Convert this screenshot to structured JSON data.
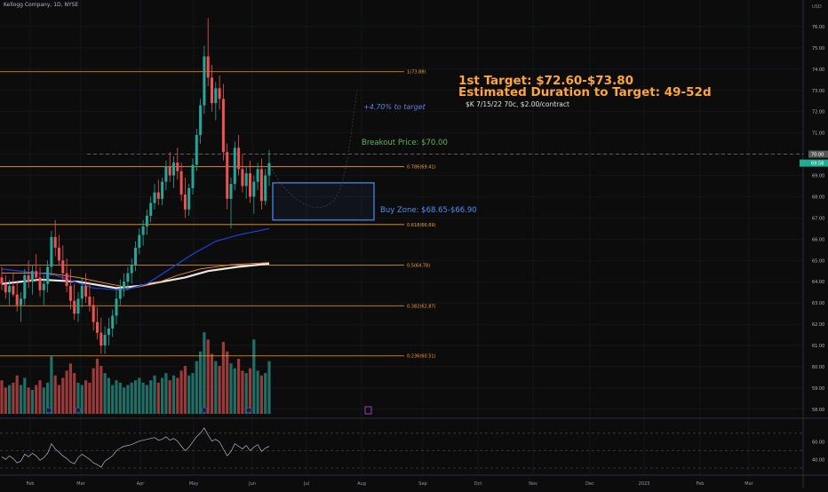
{
  "header": {
    "symbol_title": "Kellogg Company, 1D, NYSE"
  },
  "colors": {
    "background": "#0c0c0c",
    "grid": "#1c1e26",
    "up": "#26a69a",
    "down": "#ef5350",
    "vol_up": "#1f6f66",
    "vol_down": "#9c3a3a",
    "fib": "#f59d29",
    "blue_box": "#4f8df5",
    "ma_short": "#1e3dce",
    "ma_mid": "#ff8f2f",
    "ma_long": "#e8e8e8",
    "rsi": "#b2b5be",
    "annotation_target": "#ffa53a",
    "annotation_breakout": "#5fb35f",
    "annotation_buy": "#4f8df5",
    "annotation_pct": "#5d7fe0",
    "annotation_option": "#e0e0e0",
    "price_tag_breakout": "#5a5a5a",
    "price_tag_last": "#22ab94"
  },
  "annotations": {
    "target": "1st Target: $72.60-$73.80",
    "duration": "Estimated Duration to Target: 49-52d",
    "option": "$K 7/15/22 70c, $2.00/contract",
    "pct_to_target": "+4.70% to target",
    "breakout": "Breakout Price: $70.00",
    "buy_zone": "Buy Zone: $68.65-$66.90"
  },
  "chart_data": {
    "type": "candlestick",
    "title": "Kellogg Company, 1D, NYSE",
    "y_axis": {
      "label": "USD",
      "ticks": [
        58,
        59,
        60,
        61,
        62,
        63,
        64,
        65,
        66,
        67,
        68,
        69,
        70,
        71,
        72,
        73,
        74,
        75,
        76
      ],
      "range": [
        57.7,
        76.5
      ]
    },
    "x_axis": {
      "tick_labels": [
        "Feb",
        "Mar",
        "Apr",
        "May",
        "Jun",
        "Jul",
        "Aug",
        "Sep",
        "Oct",
        "Nov",
        "Dec",
        "2023",
        "Feb",
        "Mar"
      ]
    },
    "fib_levels": [
      {
        "label": "1(73.88)",
        "value": 73.88
      },
      {
        "label": "0.786(69.41)",
        "value": 69.41
      },
      {
        "label": "0.618(66.69)",
        "value": 66.69
      },
      {
        "label": "0.5(64.78)",
        "value": 64.78
      },
      {
        "label": "0.382(62.87)",
        "value": 62.87
      },
      {
        "label": "0.236(60.51)",
        "value": 60.51
      }
    ],
    "price_tags": [
      {
        "label": "70.00",
        "value": 70.0
      },
      {
        "label": "69.58",
        "value": 69.58
      }
    ],
    "breakout_level": 70.0,
    "buy_zone": {
      "top": 68.65,
      "bottom": 66.9
    },
    "rsi": {
      "range": [
        25,
        80
      ],
      "ticks": [
        40,
        60
      ],
      "band_lines": [
        30,
        50,
        70
      ]
    },
    "candles": [
      [
        64.2,
        64.7,
        63.6,
        63.9
      ],
      [
        63.9,
        64.3,
        63.2,
        63.5
      ],
      [
        63.5,
        64.1,
        62.9,
        63.8
      ],
      [
        63.8,
        64.4,
        63.3,
        63.4
      ],
      [
        63.4,
        64.0,
        62.6,
        62.9
      ],
      [
        62.9,
        63.5,
        62.1,
        63.2
      ],
      [
        63.2,
        64.6,
        62.9,
        64.3
      ],
      [
        64.3,
        65.0,
        63.7,
        64.0
      ],
      [
        64.0,
        64.8,
        63.4,
        64.5
      ],
      [
        64.5,
        65.3,
        64.0,
        64.2
      ],
      [
        64.2,
        64.7,
        63.3,
        63.6
      ],
      [
        63.6,
        64.3,
        62.9,
        63.9
      ],
      [
        63.9,
        65.0,
        63.5,
        64.7
      ],
      [
        64.7,
        66.4,
        64.3,
        66.1
      ],
      [
        66.1,
        66.9,
        65.2,
        65.6
      ],
      [
        65.6,
        66.2,
        64.8,
        65.0
      ],
      [
        65.0,
        65.7,
        64.1,
        64.4
      ],
      [
        64.4,
        65.1,
        63.5,
        63.8
      ],
      [
        63.8,
        64.6,
        62.7,
        63.1
      ],
      [
        63.1,
        63.9,
        62.2,
        62.5
      ],
      [
        62.5,
        63.5,
        62.1,
        63.2
      ],
      [
        63.2,
        64.2,
        62.8,
        63.8
      ],
      [
        63.8,
        64.4,
        63.0,
        63.3
      ],
      [
        63.3,
        64.0,
        62.6,
        62.9
      ],
      [
        62.9,
        63.3,
        61.7,
        62.1
      ],
      [
        62.1,
        62.8,
        61.3,
        61.6
      ],
      [
        61.6,
        62.3,
        60.6,
        61.0
      ],
      [
        61.0,
        61.9,
        60.6,
        61.5
      ],
      [
        61.5,
        62.3,
        61.0,
        61.8
      ],
      [
        61.8,
        62.7,
        61.4,
        62.4
      ],
      [
        62.4,
        63.6,
        62.0,
        63.2
      ],
      [
        63.2,
        64.1,
        62.9,
        63.7
      ],
      [
        63.7,
        64.4,
        63.3,
        64.0
      ],
      [
        64.0,
        64.7,
        63.6,
        64.4
      ],
      [
        64.4,
        65.1,
        63.9,
        64.8
      ],
      [
        64.8,
        65.9,
        64.5,
        65.6
      ],
      [
        65.6,
        66.5,
        65.3,
        66.2
      ],
      [
        66.2,
        66.9,
        65.7,
        66.6
      ],
      [
        66.6,
        67.4,
        66.2,
        67.1
      ],
      [
        67.1,
        68.0,
        66.8,
        67.7
      ],
      [
        67.7,
        68.6,
        67.4,
        68.2
      ],
      [
        68.2,
        68.8,
        67.6,
        67.9
      ],
      [
        67.9,
        68.9,
        67.6,
        68.7
      ],
      [
        68.7,
        69.7,
        68.3,
        69.4
      ],
      [
        69.4,
        70.1,
        68.7,
        69.0
      ],
      [
        69.0,
        69.9,
        68.4,
        69.6
      ],
      [
        69.6,
        70.3,
        68.8,
        69.2
      ],
      [
        69.2,
        69.6,
        67.8,
        68.1
      ],
      [
        68.1,
        68.9,
        67.0,
        67.4
      ],
      [
        67.4,
        68.6,
        67.1,
        68.4
      ],
      [
        68.4,
        69.8,
        68.1,
        69.5
      ],
      [
        69.5,
        71.2,
        69.2,
        70.9
      ],
      [
        70.9,
        72.6,
        70.5,
        72.3
      ],
      [
        72.3,
        75.1,
        71.9,
        74.6
      ],
      [
        74.6,
        76.4,
        73.2,
        73.6
      ],
      [
        73.6,
        74.2,
        72.0,
        72.4
      ],
      [
        72.4,
        73.4,
        71.6,
        73.1
      ],
      [
        73.1,
        73.7,
        72.1,
        72.6
      ],
      [
        72.6,
        73.3,
        69.7,
        70.1
      ],
      [
        70.1,
        70.5,
        67.4,
        67.9
      ],
      [
        67.9,
        68.9,
        66.5,
        68.6
      ],
      [
        68.6,
        70.6,
        68.3,
        70.3
      ],
      [
        70.3,
        70.9,
        69.0,
        69.3
      ],
      [
        69.3,
        70.0,
        68.2,
        68.5
      ],
      [
        68.5,
        69.4,
        67.9,
        69.1
      ],
      [
        69.1,
        69.7,
        67.7,
        68.0
      ],
      [
        68.0,
        69.0,
        67.2,
        68.7
      ],
      [
        68.7,
        69.6,
        68.3,
        69.3
      ],
      [
        69.3,
        69.8,
        67.4,
        67.8
      ],
      [
        67.8,
        69.3,
        67.6,
        69.0
      ],
      [
        69.0,
        70.2,
        68.5,
        69.58
      ]
    ],
    "volume": [
      1.4,
      1.1,
      1.2,
      1.3,
      1.6,
      1.2,
      1.5,
      1.1,
      1.0,
      1.2,
      1.4,
      1.1,
      1.3,
      2.4,
      1.6,
      1.2,
      1.5,
      1.8,
      2.1,
      1.7,
      1.3,
      1.2,
      1.4,
      1.3,
      1.9,
      2.3,
      2.0,
      1.7,
      1.5,
      1.2,
      1.4,
      1.3,
      1.1,
      1.2,
      1.3,
      1.4,
      1.5,
      1.3,
      1.2,
      1.4,
      1.6,
      1.3,
      1.5,
      1.7,
      1.4,
      1.6,
      1.5,
      1.8,
      2.0,
      1.6,
      1.7,
      2.2,
      2.6,
      3.4,
      3.1,
      2.5,
      2.2,
      2.0,
      3.0,
      2.6,
      2.1,
      1.9,
      2.3,
      1.8,
      1.7,
      1.9,
      3.1,
      1.8,
      1.6,
      1.7,
      2.2
    ],
    "ma_short": [
      [
        0,
        64.6
      ],
      [
        14,
        64.3
      ],
      [
        24,
        63.7
      ],
      [
        32,
        63.6
      ],
      [
        38,
        63.9
      ],
      [
        44,
        64.6
      ],
      [
        50,
        65.3
      ],
      [
        56,
        65.9
      ],
      [
        62,
        66.2
      ],
      [
        70,
        66.5
      ]
    ],
    "ma_mid": [
      [
        0,
        64.4
      ],
      [
        12,
        64.4
      ],
      [
        20,
        64.2
      ],
      [
        28,
        63.9
      ],
      [
        34,
        63.7
      ],
      [
        40,
        63.9
      ],
      [
        46,
        64.3
      ],
      [
        52,
        64.6
      ],
      [
        60,
        64.8
      ],
      [
        70,
        64.9
      ]
    ],
    "ma_long": [
      [
        0,
        63.9
      ],
      [
        10,
        64.1
      ],
      [
        20,
        64.0
      ],
      [
        30,
        63.7
      ],
      [
        36,
        63.8
      ],
      [
        42,
        64.0
      ],
      [
        48,
        64.2
      ],
      [
        54,
        64.5
      ],
      [
        62,
        64.7
      ],
      [
        70,
        64.85
      ]
    ],
    "rsi_values": [
      43,
      40,
      44,
      41,
      36,
      38,
      46,
      43,
      47,
      44,
      39,
      42,
      47,
      58,
      52,
      48,
      44,
      41,
      37,
      35,
      42,
      46,
      43,
      40,
      36,
      34,
      31,
      38,
      41,
      44,
      50,
      53,
      55,
      56,
      57,
      59,
      61,
      62,
      63,
      64,
      65,
      62,
      63,
      66,
      62,
      64,
      61,
      55,
      50,
      54,
      60,
      66,
      70,
      76,
      68,
      61,
      63,
      60,
      52,
      44,
      49,
      58,
      55,
      52,
      56,
      50,
      54,
      57,
      49,
      53,
      55
    ]
  }
}
